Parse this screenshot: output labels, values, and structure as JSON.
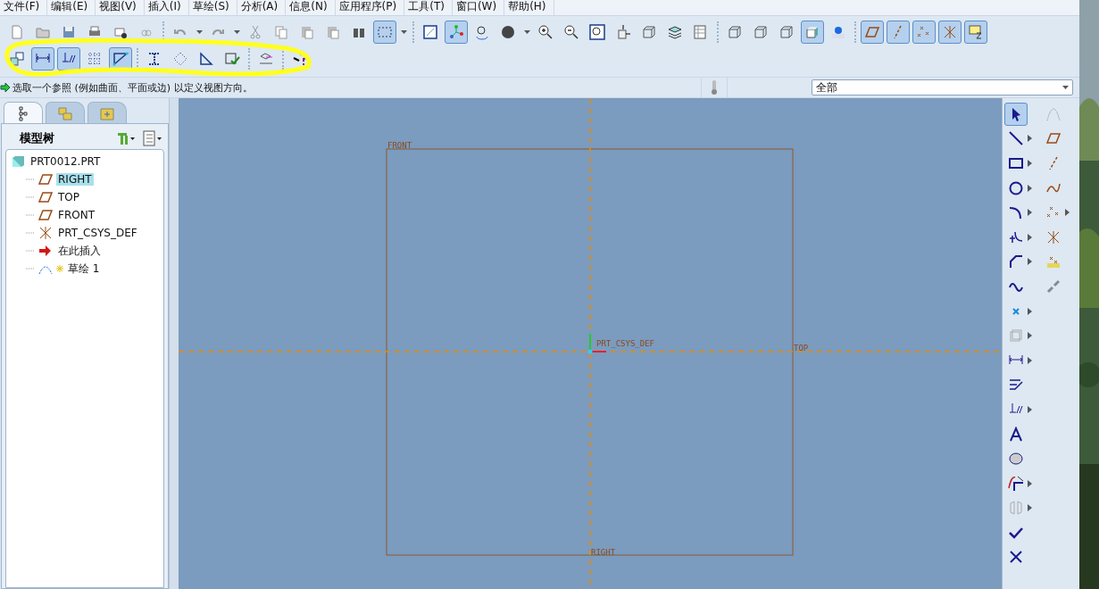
{
  "menu": [
    "文件(F)",
    "编辑(E)",
    "视图(V)",
    "插入(I)",
    "草绘(S)",
    "分析(A)",
    "信息(N)",
    "应用程序(P)",
    "工具(T)",
    "窗口(W)",
    "帮助(H)"
  ],
  "toolbar_rows": [
    {
      "groups": [
        {
          "items": [
            {
              "kind": "new",
              "selected": false,
              "dropdown": false
            },
            {
              "kind": "open",
              "selected": false,
              "dropdown": false
            },
            {
              "kind": "save",
              "selected": false,
              "dropdown": false
            },
            {
              "kind": "print",
              "selected": false,
              "dropdown": false
            },
            {
              "kind": "mail",
              "selected": false,
              "dropdown": false
            },
            {
              "kind": "link",
              "selected": false,
              "dropdown": false
            }
          ]
        },
        {
          "items": [
            {
              "kind": "undo",
              "selected": false,
              "dropdown": true
            },
            {
              "kind": "redo",
              "selected": false,
              "dropdown": true
            },
            {
              "kind": "cut",
              "selected": false,
              "dropdown": false
            },
            {
              "kind": "copy",
              "selected": false,
              "dropdown": false
            },
            {
              "kind": "paste",
              "selected": false,
              "dropdown": false
            },
            {
              "kind": "paste",
              "selected": false,
              "dropdown": false
            },
            {
              "kind": "binoculars",
              "selected": false,
              "dropdown": false
            },
            {
              "kind": "select-box",
              "selected": true,
              "dropdown": true
            }
          ]
        },
        {
          "items": [
            {
              "kind": "view",
              "selected": false,
              "dropdown": false
            },
            {
              "kind": "nodes",
              "selected": true,
              "dropdown": false
            },
            {
              "kind": "spin",
              "selected": false,
              "dropdown": false
            },
            {
              "kind": "sphere",
              "selected": false,
              "dropdown": true
            },
            {
              "kind": "zoom-in",
              "selected": false,
              "dropdown": false
            },
            {
              "kind": "zoom-out",
              "selected": false,
              "dropdown": false
            },
            {
              "kind": "zoom-fit",
              "selected": false,
              "dropdown": false
            },
            {
              "kind": "reorient",
              "selected": false,
              "dropdown": false
            },
            {
              "kind": "cube",
              "selected": false,
              "dropdown": false
            },
            {
              "kind": "layers",
              "selected": false,
              "dropdown": false
            },
            {
              "kind": "table",
              "selected": false,
              "dropdown": false
            }
          ]
        },
        {
          "items": [
            {
              "kind": "cube",
              "selected": false,
              "dropdown": false
            },
            {
              "kind": "cube",
              "selected": false,
              "dropdown": false
            },
            {
              "kind": "cube",
              "selected": false,
              "dropdown": false
            },
            {
              "kind": "cube-shaded",
              "selected": true,
              "dropdown": false
            },
            {
              "kind": "ball",
              "selected": false,
              "dropdown": false
            }
          ]
        },
        {
          "items": [
            {
              "kind": "plane",
              "selected": true,
              "dropdown": false
            },
            {
              "kind": "axis",
              "selected": true,
              "dropdown": false
            },
            {
              "kind": "points",
              "selected": true,
              "dropdown": false
            },
            {
              "kind": "csys",
              "selected": true,
              "dropdown": false
            },
            {
              "kind": "note",
              "selected": true,
              "dropdown": false
            }
          ]
        }
      ]
    },
    {
      "groups": [
        {
          "items": [
            {
              "kind": "sketch-setup",
              "selected": false,
              "dropdown": false
            },
            {
              "kind": "dimension",
              "selected": true,
              "dropdown": false
            },
            {
              "kind": "constraint",
              "selected": true,
              "dropdown": false
            },
            {
              "kind": "grid",
              "selected": false,
              "dropdown": false
            },
            {
              "kind": "vertex",
              "selected": true,
              "dropdown": false
            }
          ]
        },
        {
          "items": [
            {
              "kind": "beam",
              "selected": false,
              "dropdown": false
            },
            {
              "kind": "dotted-diamond",
              "selected": false,
              "dropdown": false
            },
            {
              "kind": "triangle",
              "selected": false,
              "dropdown": false
            },
            {
              "kind": "check-box",
              "selected": false,
              "dropdown": false
            }
          ]
        },
        {
          "items": [
            {
              "kind": "ruler",
              "selected": false,
              "dropdown": false
            }
          ]
        },
        {
          "items": [
            {
              "kind": "help",
              "selected": false,
              "dropdown": false
            }
          ]
        }
      ]
    }
  ],
  "status": {
    "message": "选取一个参照 (例如曲面、平面或边) 以定义视图方向。",
    "filter": "全部"
  },
  "panel": {
    "tabs": [
      {
        "kind": "tree",
        "selected": true
      },
      {
        "kind": "folders",
        "selected": false
      },
      {
        "kind": "favorites",
        "selected": false
      }
    ],
    "title": "模型树"
  },
  "tree": [
    {
      "label": "PRT0012.PRT",
      "kind": "part",
      "selected": false,
      "new": false,
      "children": [
        {
          "label": "RIGHT",
          "kind": "plane",
          "selected": true,
          "new": false
        },
        {
          "label": "TOP",
          "kind": "plane",
          "selected": false,
          "new": false
        },
        {
          "label": "FRONT",
          "kind": "plane",
          "selected": false,
          "new": false
        },
        {
          "label": "PRT_CSYS_DEF",
          "kind": "csys",
          "selected": false,
          "new": false
        },
        {
          "label": "在此插入",
          "kind": "insert",
          "selected": false,
          "new": false
        },
        {
          "label": "草绘 1",
          "kind": "sketch",
          "selected": false,
          "new": true
        }
      ]
    }
  ],
  "canvas": {
    "labels": [
      {
        "kind": "front",
        "text": "FRONT"
      },
      {
        "kind": "top",
        "text": "TOP"
      },
      {
        "kind": "right",
        "text": "RIGHT"
      },
      {
        "kind": "csys",
        "text": "PRT_CSYS_DEF"
      }
    ]
  },
  "sketch_tools": {
    "columns": [
      {
        "items": [
          {
            "kind": "pointer",
            "selected": true,
            "submenu": false
          },
          {
            "kind": "line",
            "selected": false,
            "submenu": true
          },
          {
            "kind": "rect",
            "selected": false,
            "submenu": true
          },
          {
            "kind": "circle",
            "selected": false,
            "submenu": true
          },
          {
            "kind": "arc",
            "selected": false,
            "submenu": true
          },
          {
            "kind": "fillet",
            "selected": false,
            "submenu": true
          },
          {
            "kind": "chamfer",
            "selected": false,
            "submenu": true
          },
          {
            "kind": "spline",
            "selected": false,
            "submenu": false
          },
          {
            "kind": "point",
            "selected": false,
            "submenu": true
          },
          {
            "kind": "offset",
            "selected": false,
            "submenu": true
          },
          {
            "kind": "dimension",
            "selected": false,
            "submenu": true
          },
          {
            "kind": "modify",
            "selected": false,
            "submenu": false
          },
          {
            "kind": "constraint",
            "selected": false,
            "submenu": true
          },
          {
            "kind": "text",
            "selected": false,
            "submenu": false
          },
          {
            "kind": "palette",
            "selected": false,
            "submenu": false
          },
          {
            "kind": "trim",
            "selected": false,
            "submenu": true
          },
          {
            "kind": "mirror",
            "selected": false,
            "submenu": true
          },
          {
            "kind": "check",
            "selected": false,
            "submenu": false
          },
          {
            "kind": "cancel",
            "selected": false,
            "submenu": false
          }
        ]
      },
      {
        "items": [
          {
            "kind": "spline-grid",
            "selected": false,
            "submenu": false
          },
          {
            "kind": "plane",
            "selected": false,
            "submenu": false
          },
          {
            "kind": "axis-line",
            "selected": false,
            "submenu": false
          },
          {
            "kind": "curve",
            "selected": false,
            "submenu": false
          },
          {
            "kind": "points",
            "selected": false,
            "submenu": true
          },
          {
            "kind": "csys",
            "selected": false,
            "submenu": false
          },
          {
            "kind": "datum-field",
            "selected": false,
            "submenu": false
          },
          {
            "kind": "chain",
            "selected": false,
            "submenu": false
          }
        ]
      }
    ]
  }
}
